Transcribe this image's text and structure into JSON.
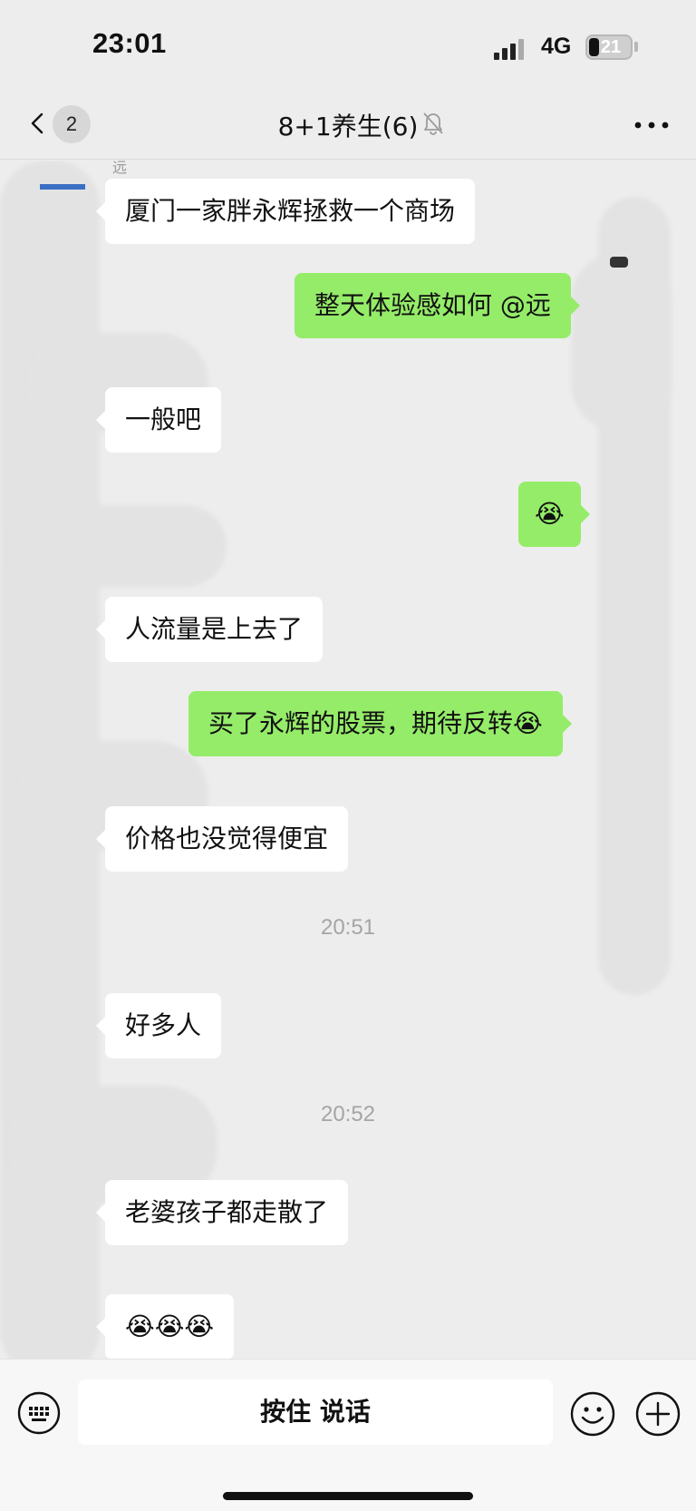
{
  "status_bar": {
    "time": "23:01",
    "network": "4G",
    "battery_level": "21",
    "battery_fraction": 0.21
  },
  "nav": {
    "unread_count": "2",
    "title": "8+1养生(6)",
    "icons": [
      "back-chevron-icon",
      "mute-bell-icon",
      "more-dots-icon"
    ]
  },
  "messages": [
    {
      "direction": "in",
      "text": "厦门一家胖永辉拯救一个商场"
    },
    {
      "direction": "out",
      "text": "整天体验感如何 @远"
    },
    {
      "direction": "in",
      "text": "一般吧"
    },
    {
      "direction": "out",
      "text": "😭"
    },
    {
      "direction": "in",
      "text": "人流量是上去了"
    },
    {
      "direction": "out",
      "text": "买了永辉的股票，期待反转😭"
    },
    {
      "direction": "in",
      "text": "价格也没觉得便宜"
    },
    {
      "type": "time",
      "text": "20:51"
    },
    {
      "direction": "in",
      "text": "好多人"
    },
    {
      "type": "time",
      "text": "20:52"
    },
    {
      "direction": "in",
      "text": "老婆孩子都走散了"
    },
    {
      "direction": "in",
      "text": "😭😭😭"
    }
  ],
  "sender_fragment": "远",
  "input_bar": {
    "hold_to_talk": "按住 说话",
    "icons": [
      "keyboard-voice-icon",
      "emoji-face-icon",
      "plus-icon"
    ]
  },
  "colors": {
    "background": "#ededed",
    "outgoing_bubble": "#95ec69",
    "incoming_bubble": "#ffffff",
    "timestamp": "#a5a5a5"
  }
}
